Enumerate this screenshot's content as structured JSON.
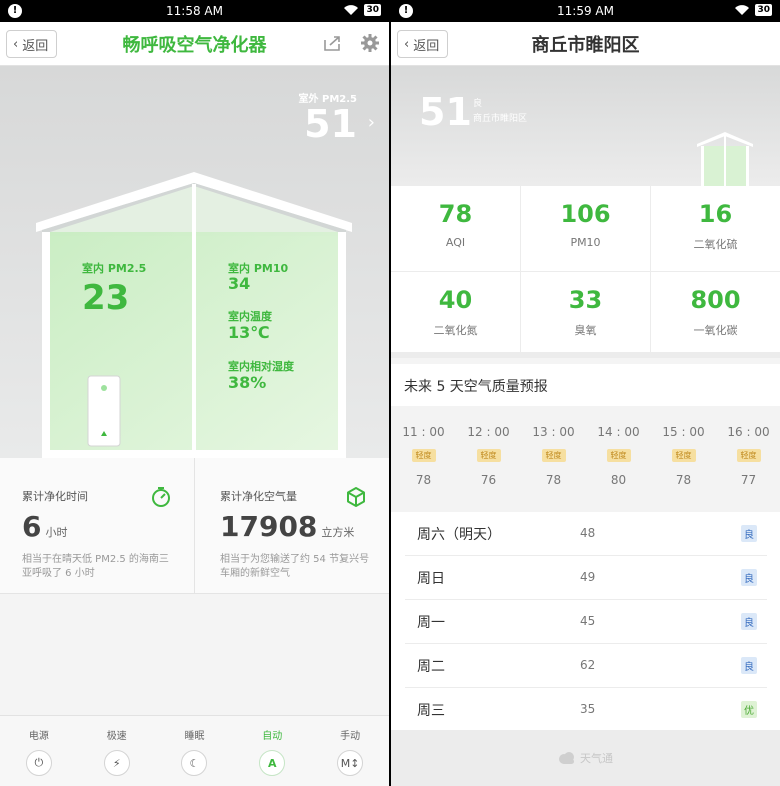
{
  "left": {
    "status": {
      "alert": "!",
      "time": "11:58 AM",
      "battery": "30"
    },
    "nav": {
      "back_label": "返回",
      "title": "畅呼吸空气净化器"
    },
    "outdoor": {
      "label": "室外 PM2.5",
      "value": "51"
    },
    "indoor": {
      "pm25_label": "室内 PM2.5",
      "pm25_value": "23",
      "pm10_label": "室内 PM10",
      "pm10_value": "34",
      "temp_label": "室内温度",
      "temp_value": "13℃",
      "humidity_label": "室内相对湿度",
      "humidity_value": "38%"
    },
    "stats": {
      "time_title": "累计净化时间",
      "time_value": "6",
      "time_unit": "小时",
      "time_desc": "相当于在晴天低 PM2.5 的海南三亚呼吸了 6 小时",
      "air_title": "累计净化空气量",
      "air_value": "17908",
      "air_unit": "立方米",
      "air_desc": "相当于为您输送了约 54 节复兴号车厢的新鲜空气"
    },
    "modes": [
      {
        "label": "电源",
        "glyph": "⏻"
      },
      {
        "label": "极速",
        "glyph": "⚡"
      },
      {
        "label": "睡眠",
        "glyph": "☾"
      },
      {
        "label": "自动",
        "glyph": "A"
      },
      {
        "label": "手动",
        "glyph": "M↕"
      }
    ],
    "accent_color": "#3fb83f"
  },
  "right": {
    "status": {
      "alert": "!",
      "time": "11:59 AM",
      "battery": "30"
    },
    "nav": {
      "back_label": "返回",
      "title": "商丘市睢阳区"
    },
    "hero": {
      "aqi": "51",
      "level": "良",
      "city": "商丘市睢阳区"
    },
    "pollutants": [
      {
        "value": "78",
        "label": "AQI"
      },
      {
        "value": "106",
        "label": "PM10"
      },
      {
        "value": "16",
        "label": "二氧化硫"
      },
      {
        "value": "40",
        "label": "二氧化氮"
      },
      {
        "value": "33",
        "label": "臭氧"
      },
      {
        "value": "800",
        "label": "一氧化碳"
      }
    ],
    "forecast_title": "未来 5 天空气质量预报",
    "hourly": [
      {
        "time": "11 : 00",
        "level": "轻度",
        "value": "78"
      },
      {
        "time": "12 : 00",
        "level": "轻度",
        "value": "76"
      },
      {
        "time": "13 : 00",
        "level": "轻度",
        "value": "78"
      },
      {
        "time": "14 : 00",
        "level": "轻度",
        "value": "80"
      },
      {
        "time": "15 : 00",
        "level": "轻度",
        "value": "78"
      },
      {
        "time": "16 : 00",
        "level": "轻度",
        "value": "77"
      }
    ],
    "daily": [
      {
        "day": "周六（明天）",
        "value": "48",
        "level": "良"
      },
      {
        "day": "周日",
        "value": "49",
        "level": "良"
      },
      {
        "day": "周一",
        "value": "45",
        "level": "良"
      },
      {
        "day": "周二",
        "value": "62",
        "level": "良"
      },
      {
        "day": "周三",
        "value": "35",
        "level": "优"
      }
    ],
    "footer": "天气通"
  }
}
